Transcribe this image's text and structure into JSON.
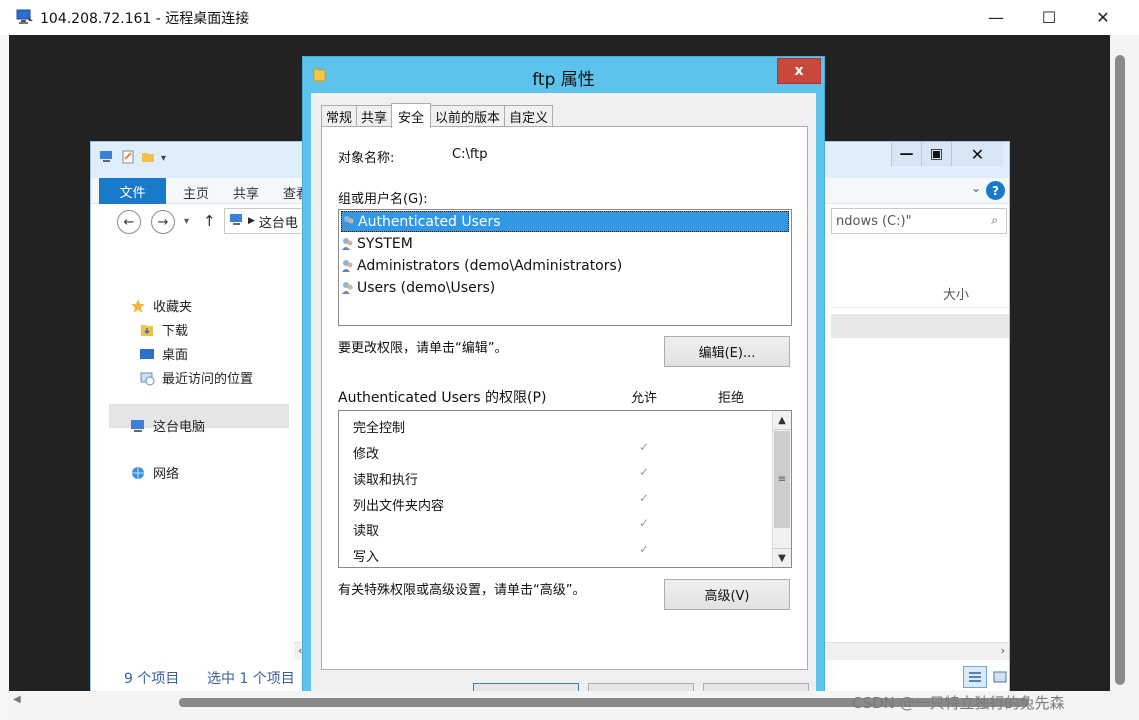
{
  "rdp": {
    "title": "104.208.72.161 - 远程桌面连接",
    "controls": {
      "minimize": "—",
      "maximize": "☐",
      "close": "✕"
    }
  },
  "explorer": {
    "ribbon": {
      "file": "文件",
      "tabs": [
        "主页",
        "共享",
        "查看"
      ]
    },
    "address": "这台电",
    "search_partial": "ndows (C:)\"",
    "nav": {
      "favorites": "收藏夹",
      "downloads": "下载",
      "desktop": "桌面",
      "recent": "最近访问的位置",
      "this_pc": "这台电脑",
      "network": "网络"
    },
    "column_size": "大小",
    "status": {
      "count": "9 个项目",
      "selected": "选中 1 个项目"
    }
  },
  "dialog": {
    "title": "ftp 属性",
    "close": "x",
    "tabs": [
      {
        "label": "常规",
        "active": false
      },
      {
        "label": "共享",
        "active": false
      },
      {
        "label": "安全",
        "active": true
      },
      {
        "label": "以前的版本",
        "active": false
      },
      {
        "label": "自定义",
        "active": false
      }
    ],
    "object_name_label": "对象名称:",
    "object_name_value": "C:\\ftp",
    "group_label": "组或用户名(G):",
    "users": [
      {
        "name": "Authenticated Users",
        "selected": true
      },
      {
        "name": "SYSTEM",
        "selected": false
      },
      {
        "name": "Administrators (demo\\Administrators)",
        "selected": false
      },
      {
        "name": "Users (demo\\Users)",
        "selected": false
      }
    ],
    "change_hint": "要更改权限，请单击“编辑”。",
    "edit_button": "编辑(E)...",
    "permissions_label": "Authenticated Users 的权限(P)",
    "allow_header": "允许",
    "deny_header": "拒绝",
    "permissions": [
      {
        "name": "完全控制",
        "allow": ""
      },
      {
        "name": "修改",
        "allow": "✓"
      },
      {
        "name": "读取和执行",
        "allow": "✓"
      },
      {
        "name": "列出文件夹内容",
        "allow": "✓"
      },
      {
        "name": "读取",
        "allow": "✓"
      },
      {
        "name": "写入",
        "allow": "✓"
      }
    ],
    "advanced_hint": "有关特殊权限或高级设置，请单击“高级”。",
    "advanced_button": "高级(V)"
  },
  "watermark": "CSDN @一只特立独行的兔先森"
}
